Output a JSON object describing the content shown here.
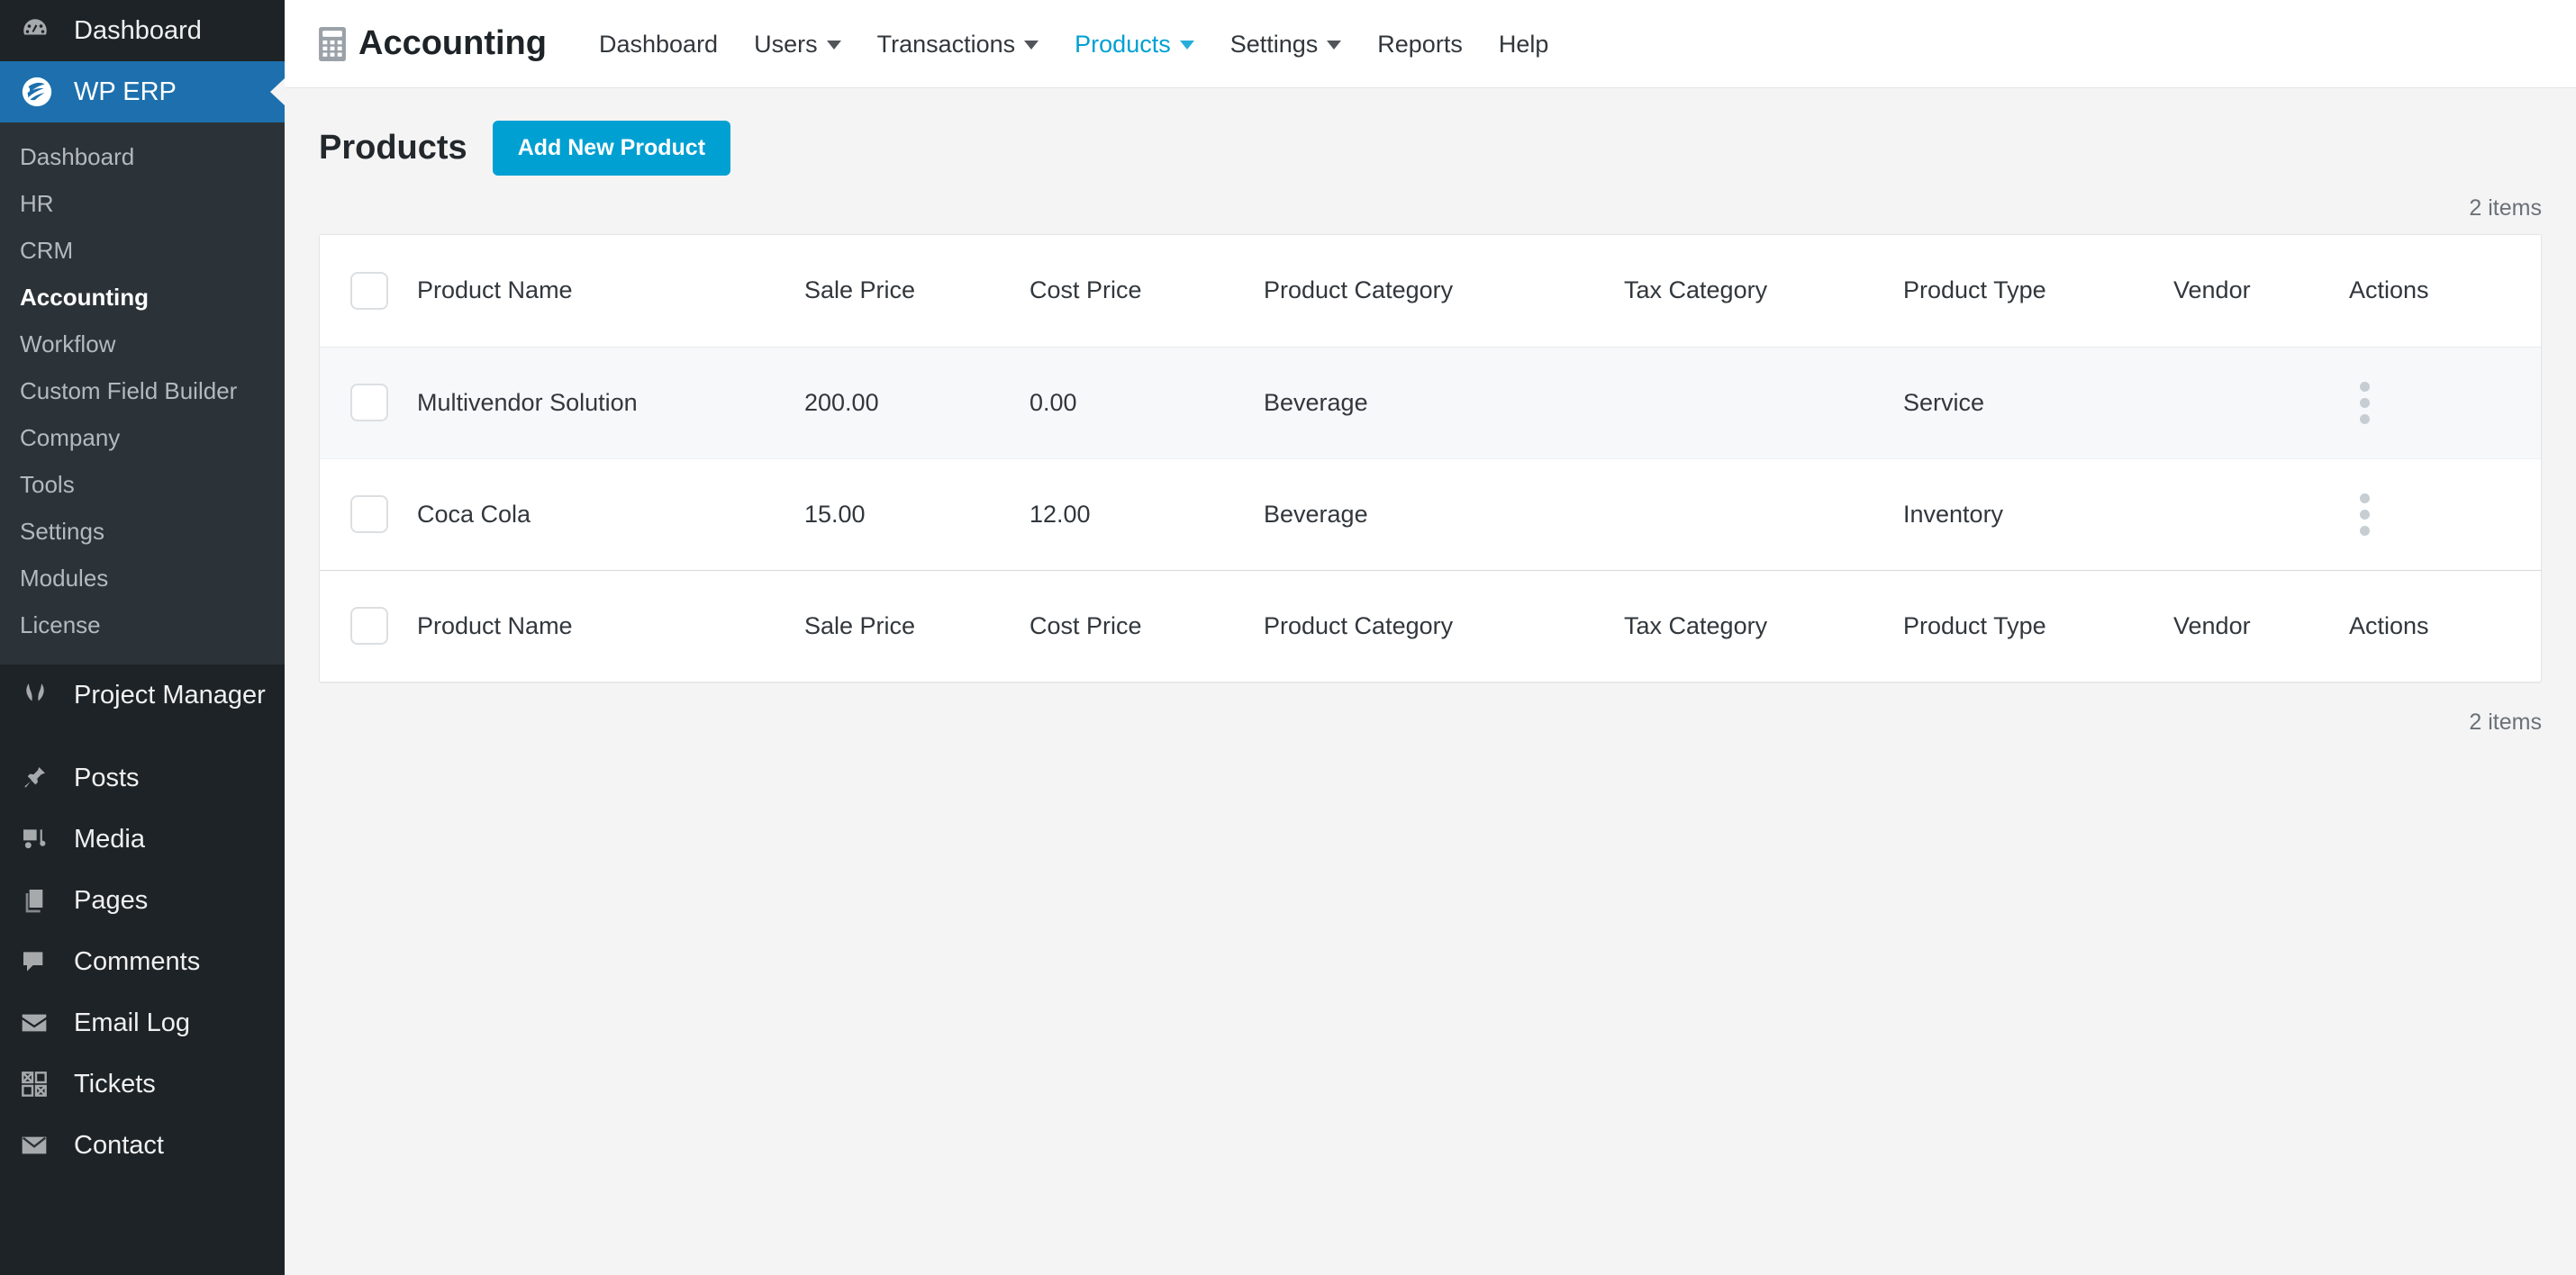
{
  "sidebar": {
    "dashboard": {
      "label": "Dashboard",
      "icon": "dashboard-icon"
    },
    "active_plugin": {
      "label": "WP ERP",
      "icon": "wperp-logo-icon"
    },
    "erp_submenu": [
      {
        "label": "Dashboard",
        "current": false
      },
      {
        "label": "HR",
        "current": false
      },
      {
        "label": "CRM",
        "current": false
      },
      {
        "label": "Accounting",
        "current": true
      },
      {
        "label": "Workflow",
        "current": false
      },
      {
        "label": "Custom Field Builder",
        "current": false
      },
      {
        "label": "Company",
        "current": false
      },
      {
        "label": "Tools",
        "current": false
      },
      {
        "label": "Settings",
        "current": false
      },
      {
        "label": "Modules",
        "current": false
      },
      {
        "label": "License",
        "current": false
      }
    ],
    "project_manager": {
      "label": "Project Manager",
      "icon": "project-manager-icon"
    },
    "wp_items": [
      {
        "label": "Posts",
        "icon": "pin-icon"
      },
      {
        "label": "Media",
        "icon": "media-icon"
      },
      {
        "label": "Pages",
        "icon": "pages-icon"
      },
      {
        "label": "Comments",
        "icon": "comment-icon"
      },
      {
        "label": "Email Log",
        "icon": "envelope-open-icon"
      },
      {
        "label": "Tickets",
        "icon": "tickets-grid-icon"
      },
      {
        "label": "Contact",
        "icon": "envelope-icon"
      }
    ]
  },
  "topnav": {
    "brand": "Accounting",
    "brand_icon": "calculator-icon",
    "links": [
      {
        "label": "Dashboard",
        "has_caret": false,
        "active": false
      },
      {
        "label": "Users",
        "has_caret": true,
        "active": false
      },
      {
        "label": "Transactions",
        "has_caret": true,
        "active": false
      },
      {
        "label": "Products",
        "has_caret": true,
        "active": true
      },
      {
        "label": "Settings",
        "has_caret": true,
        "active": false
      },
      {
        "label": "Reports",
        "has_caret": false,
        "active": false
      },
      {
        "label": "Help",
        "has_caret": false,
        "active": false
      }
    ]
  },
  "page": {
    "title": "Products",
    "add_button": "Add New Product",
    "items_count_top": "2 items",
    "items_count_bottom": "2 items"
  },
  "table": {
    "columns": [
      "Product Name",
      "Sale Price",
      "Cost Price",
      "Product Category",
      "Tax Category",
      "Product Type",
      "Vendor",
      "Actions"
    ],
    "rows": [
      {
        "name": "Multivendor Solution",
        "sale_price": "200.00",
        "cost_price": "0.00",
        "product_category": "Beverage",
        "tax_category": "",
        "product_type": "Service",
        "vendor": "",
        "actions_icon": "kebab-menu-icon"
      },
      {
        "name": "Coca Cola",
        "sale_price": "15.00",
        "cost_price": "12.00",
        "product_category": "Beverage",
        "tax_category": "",
        "product_type": "Inventory",
        "vendor": "",
        "actions_icon": "kebab-menu-icon"
      }
    ]
  },
  "colors": {
    "accent_blue": "#00a0d2",
    "sidebar_active": "#1d70ad",
    "sidebar_bg": "#1d2327",
    "submenu_bg": "#2c3338",
    "page_bg": "#f4f4f4"
  }
}
